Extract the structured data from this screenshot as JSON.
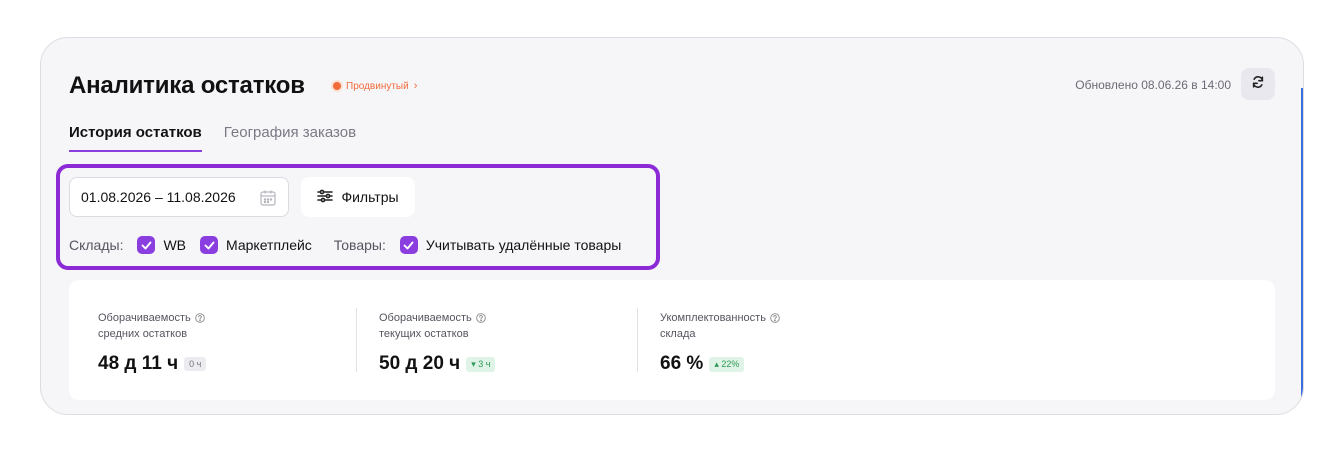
{
  "header": {
    "title": "Аналитика остатков",
    "plan_badge": "Продвинутый",
    "updated": "Обновлено 08.06.26 в 14:00"
  },
  "tabs": [
    {
      "label": "История остатков",
      "active": true
    },
    {
      "label": "География заказов",
      "active": false
    }
  ],
  "filters": {
    "date_range": "01.08.2026 – 11.08.2026",
    "filters_button": "Фильтры",
    "warehouses_label": "Склады:",
    "warehouses": [
      {
        "label": "WB",
        "checked": true
      },
      {
        "label": "Маркетплейс",
        "checked": true
      }
    ],
    "goods_label": "Товары:",
    "goods": [
      {
        "label": "Учитывать удалённые товары",
        "checked": true
      }
    ]
  },
  "metrics": [
    {
      "label_line1": "Оборачиваемость",
      "label_line2": "средних остатков",
      "value": "48 д 11 ч",
      "delta": "0 ч",
      "trend": "neutral"
    },
    {
      "label_line1": "Оборачиваемость",
      "label_line2": "текущих остатков",
      "value": "50 д 20 ч",
      "delta": "3 ч",
      "trend": "down"
    },
    {
      "label_line1": "Укомплектованность",
      "label_line2": "склада",
      "value": "66 %",
      "delta": "22%",
      "trend": "up"
    }
  ],
  "colors": {
    "accent": "#8b3ee0",
    "highlight_border": "#8c2bd6",
    "plan_badge": "#f26b3a",
    "positive": "#2f9a57"
  },
  "icons": [
    "refresh-icon",
    "calendar-icon",
    "filter-sliders-icon",
    "check-icon",
    "help-icon",
    "chevron-right-icon"
  ]
}
